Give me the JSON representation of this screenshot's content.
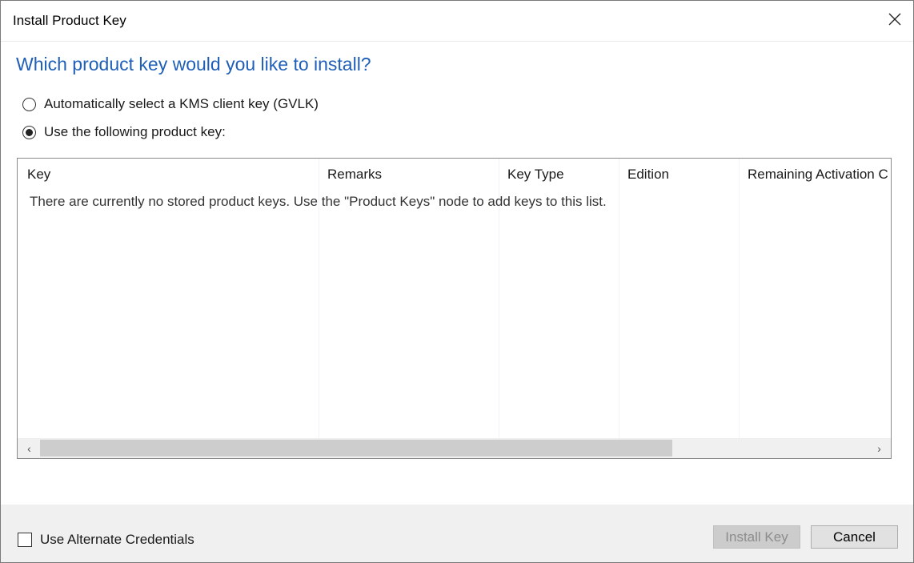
{
  "window": {
    "title": "Install Product Key"
  },
  "heading": "Which product key would you like to install?",
  "options": {
    "auto_kms": {
      "label": "Automatically select a KMS client key (GVLK)",
      "selected": false
    },
    "use_following": {
      "label": "Use the following product key:",
      "selected": true
    }
  },
  "list": {
    "columns": [
      "Key",
      "Remarks",
      "Key Type",
      "Edition",
      "Remaining Activation C"
    ],
    "empty_message": "There are currently no stored product keys. Use the \"Product Keys\" node to add keys to this list."
  },
  "scrollbar": {
    "left_arrow": "‹",
    "right_arrow": "›"
  },
  "footer": {
    "alt_credentials_label": "Use Alternate Credentials",
    "alt_credentials_checked": false,
    "install_label": "Install Key",
    "cancel_label": "Cancel"
  },
  "colors": {
    "heading": "#1f5fb8",
    "footer_bg": "#f0f0f0"
  }
}
